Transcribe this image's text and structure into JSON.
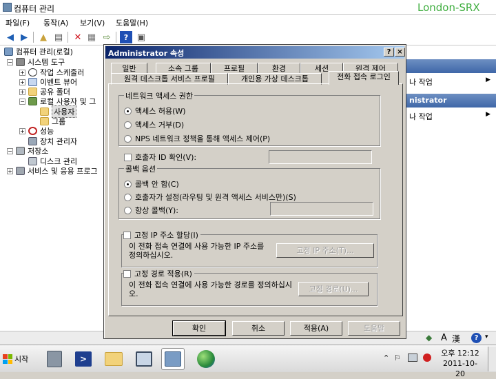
{
  "main_window": {
    "title": "컴퓨터 관리",
    "watermark": "London-SRX"
  },
  "menu": [
    "파일(F)",
    "동작(A)",
    "보기(V)",
    "도움말(H)"
  ],
  "tree": [
    {
      "label": "컴퓨터 관리(로컬)"
    },
    {
      "label": "시스템 도구"
    },
    {
      "label": "작업 스케줄러"
    },
    {
      "label": "이벤트 뷰어"
    },
    {
      "label": "공유 폴더"
    },
    {
      "label": "로컬 사용자 및 그"
    },
    {
      "label": "사용자"
    },
    {
      "label": "그룹"
    },
    {
      "label": "성능"
    },
    {
      "label": "장치 관리자"
    },
    {
      "label": "저장소"
    },
    {
      "label": "디스크 관리"
    },
    {
      "label": "서비스 및 응용 프로그"
    }
  ],
  "actions": {
    "header1": "",
    "row1": "나 작업",
    "header2": "nistrator",
    "row2": "나 작업"
  },
  "dialog": {
    "title": "Administrator 속성",
    "help_btn": "?",
    "close_btn": "×",
    "tabs_row1": [
      "일반",
      "소속 그룹",
      "프로필",
      "환경",
      "세션",
      "원격 제어"
    ],
    "tabs_row2": [
      "원격 데스크톱 서비스 프로필",
      "개인용 가상 데스크톱",
      "전화 접속 로그인"
    ],
    "network_access": {
      "title": "네트워크 액세스 권한",
      "options": [
        "액세스 허용(W)",
        "액세스 거부(D)",
        "NPS 네트워크 정책을 통해 액세스 제어(P)"
      ],
      "selected": 0
    },
    "verify_caller_id": "호출자 ID 확인(V):",
    "callback": {
      "title": "콜백 옵션",
      "options": [
        "콜백 안 함(C)",
        "호출자가 설정(라우팅 및 원격 액세스 서비스만)(S)",
        "항상 콜백(Y):"
      ],
      "selected": 0
    },
    "static_ip": {
      "checkbox": "고정 IP 주소 할당(I)",
      "description": "이 전화 접속 연결에 사용 가능한 IP 주소를 정의하십시오.",
      "button": "고정 IP 주소(T)..."
    },
    "static_routes": {
      "checkbox": "고정 경로 적용(R)",
      "description": "이 전화 접속 연결에 사용 가능한 경로를 정의하십시오.",
      "button": "고정 경로(U)..."
    },
    "buttons": {
      "ok": "확인",
      "cancel": "취소",
      "apply": "적용(A)",
      "help": "도움말"
    }
  },
  "taskbar": {
    "start": "시작",
    "clock_ampm_time": "오후 12:12",
    "clock_date": "2011-10-20"
  }
}
